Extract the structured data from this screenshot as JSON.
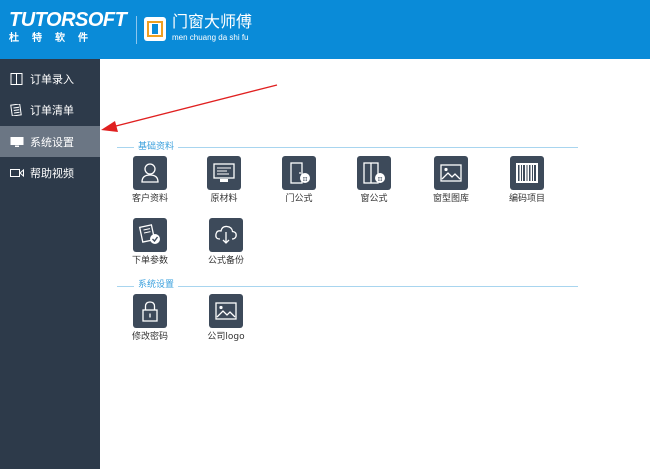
{
  "header": {
    "brand_en": "TUTORSOFT",
    "brand_cn": "杜特软件",
    "app_title": "门窗大师傅",
    "app_subtitle": "men chuang da shi fu"
  },
  "sidebar": {
    "items": [
      {
        "label": "订单录入",
        "icon": "door-icon"
      },
      {
        "label": "订单清单",
        "icon": "list-icon"
      },
      {
        "label": "系统设置",
        "icon": "monitor-icon",
        "active": true
      },
      {
        "label": "帮助视频",
        "icon": "video-icon"
      }
    ]
  },
  "sections": {
    "basic": {
      "title": "基础资料",
      "tiles": [
        {
          "label": "客户资料",
          "icon": "user-icon"
        },
        {
          "label": "原材料",
          "icon": "material-icon"
        },
        {
          "label": "门公式",
          "icon": "door-formula-icon"
        },
        {
          "label": "窗公式",
          "icon": "window-formula-icon"
        },
        {
          "label": "窗型图库",
          "icon": "image-icon"
        },
        {
          "label": "编码项目",
          "icon": "barcode-icon"
        },
        {
          "label": "下单参数",
          "icon": "order-params-icon"
        },
        {
          "label": "公式备份",
          "icon": "cloud-backup-icon"
        }
      ]
    },
    "system": {
      "title": "系统设置",
      "tiles": [
        {
          "label": "修改密码",
          "icon": "lock-icon"
        },
        {
          "label": "公司logo",
          "icon": "logo-image-icon"
        }
      ]
    }
  },
  "colors": {
    "header": "#0a8bd8",
    "sidebar": "#2d3a4a",
    "sidebar_active": "#6b7684",
    "tile": "#3d4a5a",
    "section_title": "#3aa0dd",
    "arrow": "#e02020"
  }
}
